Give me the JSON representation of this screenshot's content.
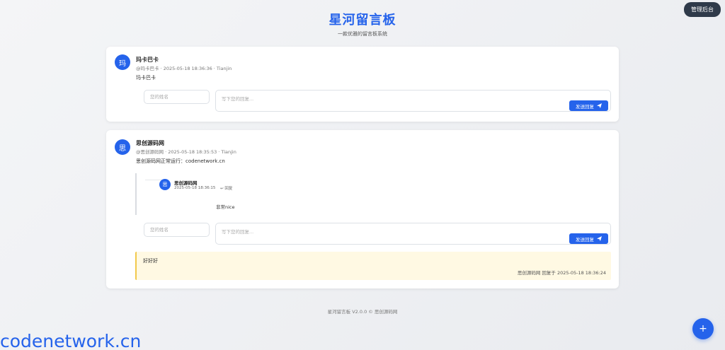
{
  "header": {
    "title": "星河留言板",
    "subtitle": "一款优雅的留言板系统",
    "admin_button": "管理后台"
  },
  "messages": [
    {
      "avatar": "玛",
      "name": "玛卡巴卡",
      "meta": "@玛卡巴卡 · 2025-05-18 18:36:36 · Tianjin",
      "content": "玛卡巴卡",
      "reply_form": {
        "name_placeholder": "您的姓名",
        "content_placeholder": "写下您的回复...",
        "send_label": "发送回复"
      }
    },
    {
      "avatar": "思",
      "name": "思创源码网",
      "meta": "@思创源码网 · 2025-05-18 18:35:53 · Tianjin",
      "content": "思创源码网正常运行：codenetwork.cn",
      "replies": [
        {
          "avatar": "思",
          "name": "思创源码网",
          "time": "2025-05-18 18:36:15",
          "reply_label": "回复",
          "content": "非常nice"
        }
      ],
      "reply_form": {
        "name_placeholder": "您的姓名",
        "content_placeholder": "写下您的回复...",
        "send_label": "发送回复"
      },
      "admin_reply": {
        "content": "好好好",
        "meta": "思创源码网 回复于 2025-05-18 18:36:24"
      }
    }
  ],
  "footer": "星河留言板 V2.0.0 © 思创源码网",
  "watermark": "codenetwork.cn",
  "fab_label": "+",
  "colors": {
    "accent": "#2563eb",
    "admin_button_bg": "#2f3a4a",
    "admin_reply_bg": "#fff9e3",
    "admin_reply_border": "#f2c94c"
  },
  "icons": {
    "send": "paper-plane-icon",
    "reply": "reply-arrow-icon",
    "fab": "plus-icon"
  }
}
